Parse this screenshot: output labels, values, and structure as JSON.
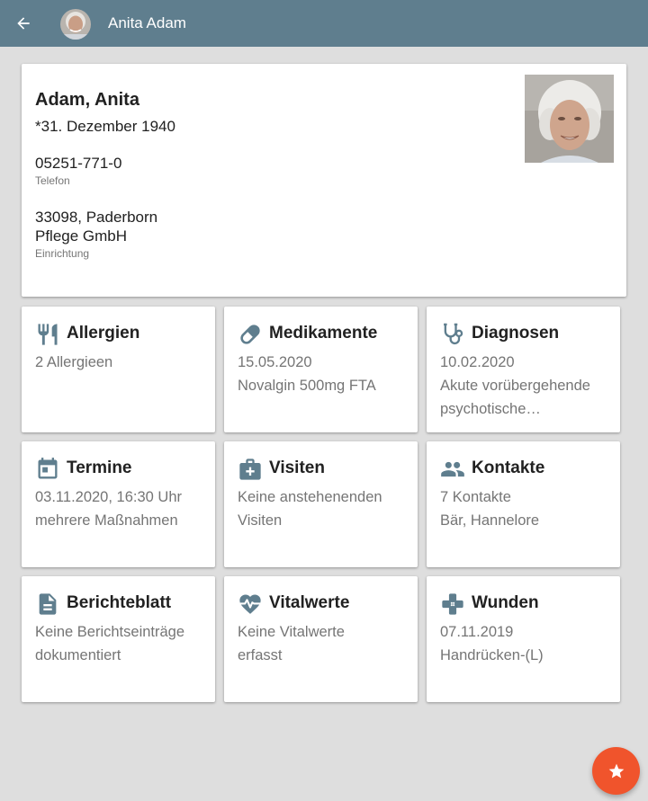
{
  "appbar": {
    "title": "Anita Adam",
    "background": "#5f7e8e"
  },
  "profile": {
    "name": "Adam, Anita",
    "birthdate": "*31. Dezember 1940",
    "phone": "05251-771-0",
    "phone_caption": "Telefon",
    "address_line1": "33098, Paderborn",
    "address_line2": "Pflege GmbH",
    "address_caption": "Einrichtung"
  },
  "tiles": [
    {
      "title": "Allergien",
      "icon": "cutlery-icon",
      "lines": [
        "2 Allergieen"
      ]
    },
    {
      "title": "Medikamente",
      "icon": "pill-icon",
      "lines": [
        "15.05.2020",
        "Novalgin 500mg FTA"
      ]
    },
    {
      "title": "Diagnosen",
      "icon": "stethoscope-icon",
      "lines": [
        "10.02.2020",
        "Akute vorübergehende",
        "psychotische…"
      ]
    },
    {
      "title": "Termine",
      "icon": "calendar-icon",
      "lines": [
        "03.11.2020, 16:30 Uhr",
        "mehrere Maßnahmen"
      ]
    },
    {
      "title": "Visiten",
      "icon": "medical-bag-icon",
      "lines": [
        "Keine anstehenenden",
        "Visiten"
      ]
    },
    {
      "title": "Kontakte",
      "icon": "people-icon",
      "lines": [
        "7 Kontakte",
        "Bär, Hannelore"
      ]
    },
    {
      "title": "Berichteblatt",
      "icon": "document-icon",
      "lines": [
        "Keine Berichtseinträge",
        "dokumentiert"
      ]
    },
    {
      "title": "Vitalwerte",
      "icon": "heart-pulse-icon",
      "lines": [
        "Keine Vitalwerte",
        "erfasst"
      ]
    },
    {
      "title": "Wunden",
      "icon": "bandage-icon",
      "lines": [
        "07.11.2019",
        "Handrücken-(L)"
      ]
    }
  ],
  "colors": {
    "icon": "#5f7e8e",
    "fab": "#f0542c",
    "background": "#dedede"
  }
}
